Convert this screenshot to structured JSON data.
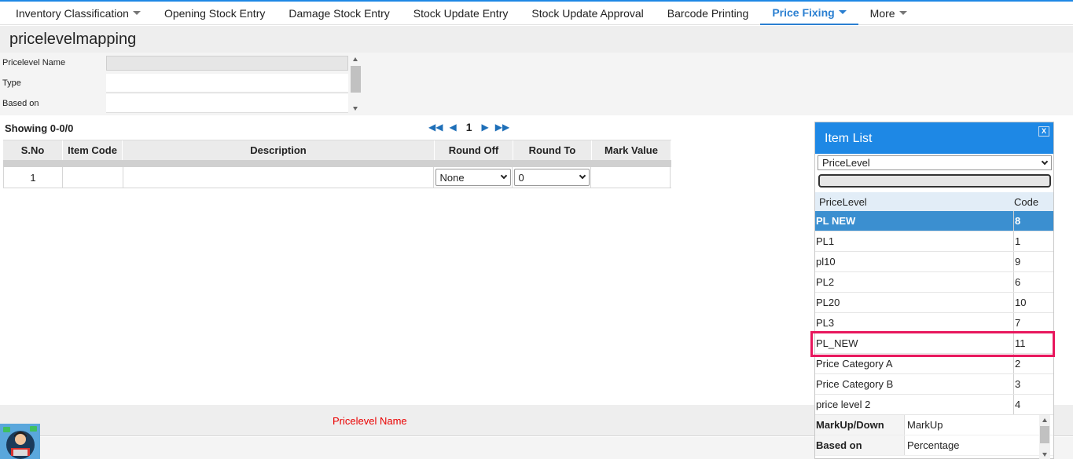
{
  "nav": {
    "items": [
      {
        "label": "Inventory Classification",
        "dropdown": true,
        "active": false
      },
      {
        "label": "Opening Stock Entry",
        "dropdown": false,
        "active": false
      },
      {
        "label": "Damage Stock Entry",
        "dropdown": false,
        "active": false
      },
      {
        "label": "Stock Update Entry",
        "dropdown": false,
        "active": false
      },
      {
        "label": "Stock Update Approval",
        "dropdown": false,
        "active": false
      },
      {
        "label": "Barcode Printing",
        "dropdown": false,
        "active": false
      },
      {
        "label": "Price Fixing",
        "dropdown": true,
        "active": true
      },
      {
        "label": "More",
        "dropdown": true,
        "active": false
      }
    ]
  },
  "page": {
    "title": "pricelevelmapping"
  },
  "form": {
    "fields": [
      {
        "label": "Pricelevel Name",
        "value": ""
      },
      {
        "label": "Type",
        "value": ""
      },
      {
        "label": "Based on",
        "value": ""
      }
    ]
  },
  "pagination": {
    "showing": "Showing 0-0/0",
    "page": "1"
  },
  "grid": {
    "columns": [
      "S.No",
      "Item Code",
      "Description",
      "Round Off",
      "Round To",
      "Mark Value"
    ],
    "rows": [
      {
        "sno": "1",
        "item_code": "",
        "description": "",
        "round_off": "None",
        "round_to": "0",
        "mark_value": ""
      }
    ]
  },
  "bottom": {
    "label": "Pricelevel Name"
  },
  "item_list": {
    "title": "Item List",
    "close": "X",
    "selector": "PriceLevel",
    "search_value": "",
    "columns": [
      "PriceLevel",
      "Code"
    ],
    "rows": [
      {
        "name": "PL NEW",
        "code": "8",
        "selected": true
      },
      {
        "name": "PL1",
        "code": "1"
      },
      {
        "name": "pl10",
        "code": "9"
      },
      {
        "name": "PL2",
        "code": "6"
      },
      {
        "name": "PL20",
        "code": "10"
      },
      {
        "name": "PL3",
        "code": "7"
      },
      {
        "name": "PL_NEW",
        "code": "11",
        "highlighted": true
      },
      {
        "name": "Price Category A",
        "code": "2"
      },
      {
        "name": "Price Category B",
        "code": "3"
      },
      {
        "name": "price level 2",
        "code": "4"
      }
    ],
    "properties": [
      {
        "label": "MarkUp/Down",
        "value": "MarkUp"
      },
      {
        "label": "Based on",
        "value": "Percentage"
      }
    ]
  },
  "colors": {
    "accent": "#1e88e5",
    "selected_row": "#3b8fd0",
    "highlight": "#e8175d",
    "error_label": "#ea0000"
  }
}
